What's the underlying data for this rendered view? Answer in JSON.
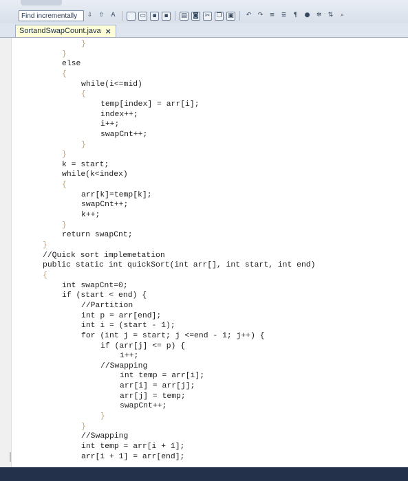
{
  "toolbar": {
    "find_value": "Find incrementally",
    "icons": [
      "find-next-icon",
      "find-prev-icon",
      "match-case-icon",
      "new-file-icon",
      "open-folder-icon",
      "save-icon",
      "save-all-icon",
      "print-icon",
      "preview-icon",
      "cut-icon",
      "copy-icon",
      "paste-icon",
      "undo-icon",
      "redo-icon",
      "indent-icon",
      "outdent-icon",
      "paragraph-icon",
      "run-icon",
      "settings-icon",
      "sort-icon",
      "zoom-icon"
    ]
  },
  "tab": {
    "title": "SortandSwapCount.java",
    "close": "×"
  },
  "code": {
    "lines": [
      {
        "text": "}",
        "indent": 1,
        "brace": true
      },
      {
        "text": "}",
        "indent": 0,
        "brace": true
      },
      {
        "text": "else",
        "indent": 0
      },
      {
        "text": "{",
        "indent": 0,
        "brace": true
      },
      {
        "text": "while(i<=mid)",
        "indent": 1
      },
      {
        "text": "{",
        "indent": 1,
        "brace": true
      },
      {
        "text": "temp[index] = arr[i];",
        "indent": 2
      },
      {
        "text": "index++;",
        "indent": 2
      },
      {
        "text": "i++;",
        "indent": 2
      },
      {
        "text": "swapCnt++;",
        "indent": 2
      },
      {
        "text": "}",
        "indent": 1,
        "brace": true
      },
      {
        "text": "}",
        "indent": 0,
        "brace": true
      },
      {
        "text": "k = start;",
        "indent": 0
      },
      {
        "text": "while(k<index)",
        "indent": 0
      },
      {
        "text": "{",
        "indent": 0,
        "brace": true
      },
      {
        "text": "arr[k]=temp[k];",
        "indent": 1
      },
      {
        "text": "swapCnt++;",
        "indent": 1
      },
      {
        "text": "k++;",
        "indent": 1
      },
      {
        "text": "}",
        "indent": 0,
        "brace": true
      },
      {
        "text": "return swapCnt;",
        "indent": 0
      },
      {
        "text": "}",
        "indent": -1,
        "brace": true
      },
      {
        "text": "//Quick sort implemetation",
        "indent": -1
      },
      {
        "text": "public static int quickSort(int arr[], int start, int end)",
        "indent": -1
      },
      {
        "text": "{",
        "indent": -1,
        "brace": true
      },
      {
        "text": "int swapCnt=0;",
        "indent": 0
      },
      {
        "text": "if (start < end) {",
        "indent": 0
      },
      {
        "text": "//Partition",
        "indent": 1
      },
      {
        "text": "int p = arr[end];",
        "indent": 1
      },
      {
        "text": "int i = (start - 1);",
        "indent": 1
      },
      {
        "text": "for (int j = start; j <=end - 1; j++) {",
        "indent": 1
      },
      {
        "text": "if (arr[j] <= p) {",
        "indent": 2
      },
      {
        "text": "i++;",
        "indent": 3
      },
      {
        "text": "//Swapping",
        "indent": 2
      },
      {
        "text": "int temp = arr[i];",
        "indent": 3
      },
      {
        "text": "arr[i] = arr[j];",
        "indent": 3
      },
      {
        "text": "arr[j] = temp;",
        "indent": 3
      },
      {
        "text": "swapCnt++;",
        "indent": 3
      },
      {
        "text": "}",
        "indent": 2,
        "brace": true
      },
      {
        "text": "}",
        "indent": 1,
        "brace": true
      },
      {
        "text": "//Swapping",
        "indent": 1
      },
      {
        "text": "int temp = arr[i + 1];",
        "indent": 1
      },
      {
        "text": "arr[i + 1] = arr[end];",
        "indent": 1
      }
    ]
  }
}
